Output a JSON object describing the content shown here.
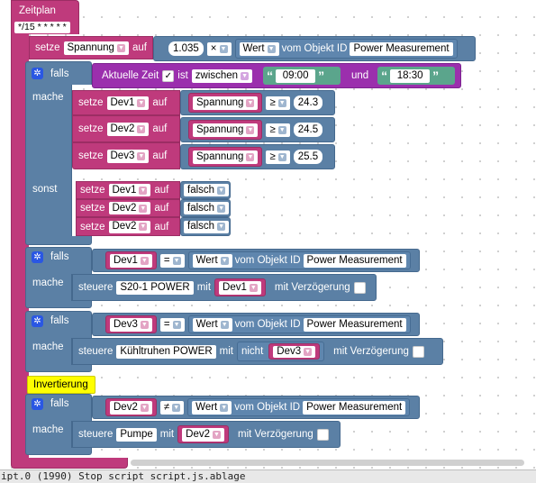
{
  "title": "Zeitplan",
  "cron": "*/15 * * * * *",
  "setze": "setze",
  "auf": "auf",
  "falls": "falls",
  "mache": "mache",
  "sonst": "sonst",
  "steuere": "steuere",
  "mit": "mit",
  "mit_verz": "mit Verzögerung",
  "vom_objekt": "vom Objekt ID",
  "nicht": "nicht",
  "ist": "ist",
  "und": "und",
  "row1": {
    "var": "Spannung",
    "factor": "1.035",
    "op": "×",
    "prop": "Wert",
    "obj": "Power Measurement"
  },
  "cond1": {
    "label": "Aktuelle Zeit",
    "mode": "zwischen",
    "from": "09:00",
    "to": "18:30"
  },
  "setzes": [
    {
      "var": "Dev1",
      "src": "Spannung",
      "cmp": "≥",
      "val": "24.3"
    },
    {
      "var": "Dev2",
      "src": "Spannung",
      "cmp": "≥",
      "val": "24.5"
    },
    {
      "var": "Dev3",
      "src": "Spannung",
      "cmp": "≥",
      "val": "25.5"
    }
  ],
  "sonst_items": [
    {
      "var": "Dev1",
      "val": "falsch"
    },
    {
      "var": "Dev2",
      "val": "falsch"
    },
    {
      "var": "Dev2",
      "val": "falsch"
    }
  ],
  "if2": {
    "var": "Dev1",
    "cmp": "=",
    "prop": "Wert",
    "obj": "Power Measurement",
    "dev": "S20-1 POWER",
    "arg": "Dev1"
  },
  "if3": {
    "var": "Dev3",
    "cmp": "=",
    "prop": "Wert",
    "obj": "Power Measurement",
    "dev": "Kühltruhen POWER",
    "arg": "Dev3"
  },
  "comment": "Invertierung",
  "if4": {
    "var": "Dev2",
    "cmp": "≠",
    "prop": "Wert",
    "obj": "Power Measurement",
    "dev": "Pumpe",
    "arg": "Dev2"
  },
  "status": "ipt.0 (1990) Stop script script.js.ablage",
  "colors": {
    "event": "#bf3a7c",
    "logic": "#5b80a5",
    "var": "#bf3a7c",
    "time": "#9b2fad",
    "text": "#5ba58c",
    "comment": "#ffff00"
  }
}
